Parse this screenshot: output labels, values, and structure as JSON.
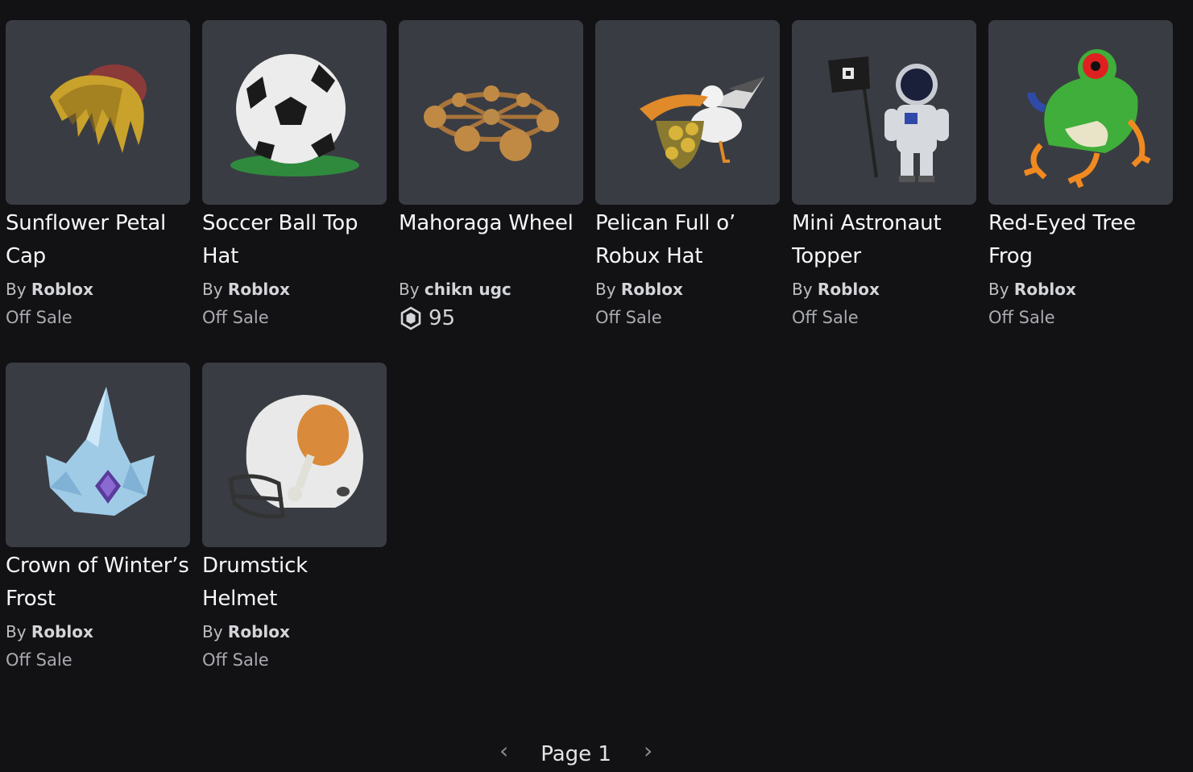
{
  "items": [
    {
      "name": "Sunflower Petal Cap",
      "by": "By",
      "creator": "Roblox",
      "price": "Off Sale",
      "icon": "sunflower-petal-cap-thumbnail",
      "robux": false
    },
    {
      "name": "Soccer Ball Top Hat",
      "by": "By",
      "creator": "Roblox",
      "price": "Off Sale",
      "icon": "soccer-ball-top-hat-thumbnail",
      "robux": false
    },
    {
      "name": "Mahoraga Wheel",
      "by": "By",
      "creator": "chikn ugc",
      "price": "95",
      "icon": "mahoraga-wheel-thumbnail",
      "robux": true
    },
    {
      "name": "Pelican Full o’ Robux Hat",
      "by": "By",
      "creator": "Roblox",
      "price": "Off Sale",
      "icon": "pelican-hat-thumbnail",
      "robux": false
    },
    {
      "name": "Mini Astronaut Topper",
      "by": "By",
      "creator": "Roblox",
      "price": "Off Sale",
      "icon": "mini-astronaut-thumbnail",
      "robux": false
    },
    {
      "name": "Red-Eyed Tree Frog",
      "by": "By",
      "creator": "Roblox",
      "price": "Off Sale",
      "icon": "tree-frog-thumbnail",
      "robux": false
    },
    {
      "name": "Crown of Winter’s Frost",
      "by": "By",
      "creator": "Roblox",
      "price": "Off Sale",
      "icon": "ice-crown-thumbnail",
      "robux": false
    },
    {
      "name": "Drumstick Helmet",
      "by": "By",
      "creator": "Roblox",
      "price": "Off Sale",
      "icon": "drumstick-helmet-thumbnail",
      "robux": false
    }
  ],
  "pagination": {
    "label": "Page 1",
    "prev_icon": "chevron-left-icon",
    "next_icon": "chevron-right-icon"
  },
  "colors": {
    "background": "#121215",
    "card": "#3a3c43",
    "text": "#f7f7f8",
    "muted": "#a9abb0"
  }
}
